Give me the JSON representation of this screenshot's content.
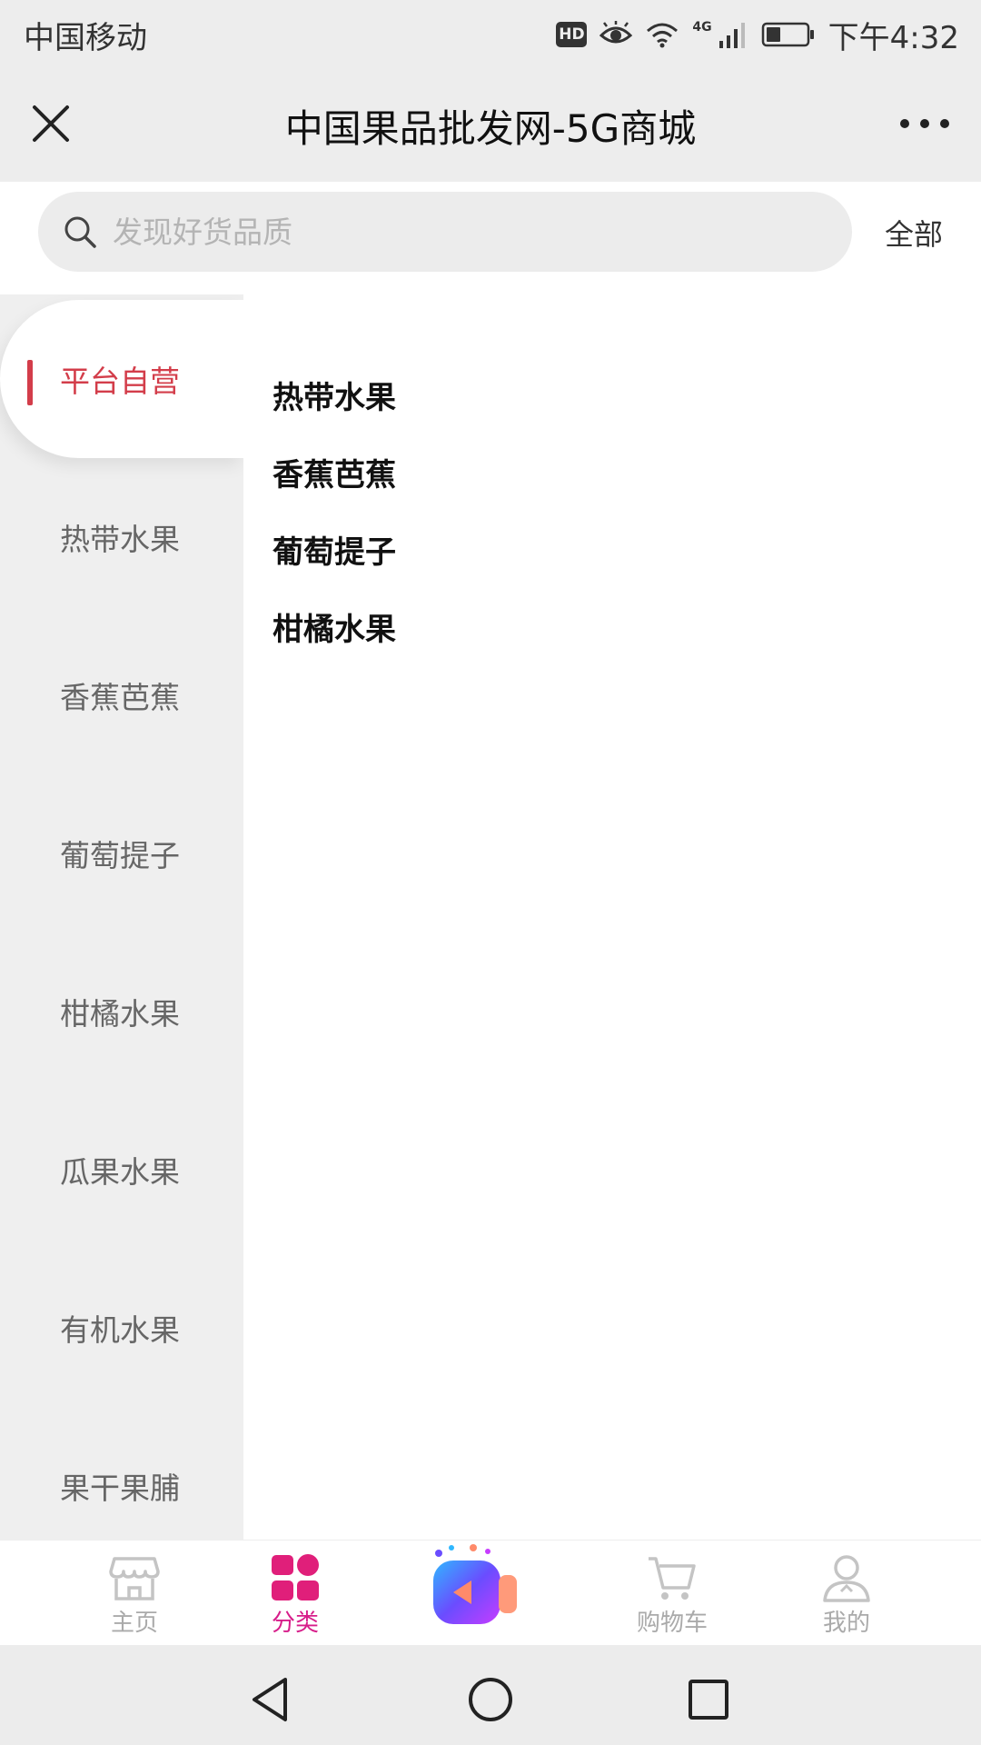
{
  "status_bar": {
    "carrier": "中国移动",
    "hd": "HD",
    "network": "4G",
    "time": "下午4:32",
    "battery_level": 0.35
  },
  "title_bar": {
    "title": "中国果品批发网-5G商城"
  },
  "search": {
    "placeholder": "发现好货品质",
    "all_label": "全部"
  },
  "sidebar": {
    "items": [
      {
        "label": "平台自营",
        "active": true
      },
      {
        "label": "热带水果",
        "active": false
      },
      {
        "label": "香蕉芭蕉",
        "active": false
      },
      {
        "label": "葡萄提子",
        "active": false
      },
      {
        "label": "柑橘水果",
        "active": false
      },
      {
        "label": "瓜果水果",
        "active": false
      },
      {
        "label": "有机水果",
        "active": false
      },
      {
        "label": "果干果脯",
        "active": false
      }
    ]
  },
  "subcategories": [
    {
      "label": "热带水果"
    },
    {
      "label": "香蕉芭蕉"
    },
    {
      "label": "葡萄提子"
    },
    {
      "label": "柑橘水果"
    }
  ],
  "tab_bar": {
    "items": [
      {
        "label": "主页",
        "icon": "store-icon",
        "active": false
      },
      {
        "label": "分类",
        "icon": "category-grid-icon",
        "active": true
      },
      {
        "label": "",
        "icon": "video-camera-icon",
        "active": false
      },
      {
        "label": "购物车",
        "icon": "cart-icon",
        "active": false
      },
      {
        "label": "我的",
        "icon": "user-icon",
        "active": false
      }
    ]
  },
  "colors": {
    "accent_red": "#d33d4a",
    "tab_active": "#d71d8a",
    "sidebar_bg": "#efefef"
  }
}
